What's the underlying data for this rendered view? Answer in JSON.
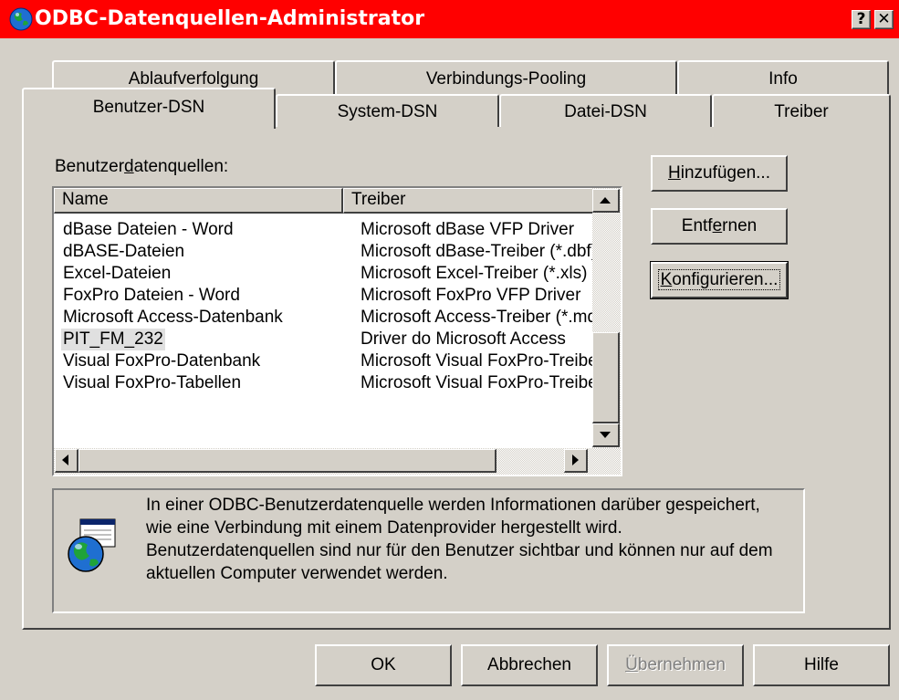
{
  "window": {
    "title": "ODBC-Datenquellen-Administrator",
    "help_glyph": "?",
    "close_glyph": "✕"
  },
  "tabs_back": [
    "Ablaufverfolgung",
    "Verbindungs-Pooling",
    "Info"
  ],
  "tabs_front": [
    "Benutzer-DSN",
    "System-DSN",
    "Datei-DSN",
    "Treiber"
  ],
  "active_tab": "Benutzer-DSN",
  "list_label": {
    "pre": "Benutzer",
    "accel": "d",
    "post": "atenquellen:"
  },
  "list": {
    "columns": [
      "Name",
      "Treiber"
    ],
    "rows": [
      {
        "name": "dBase Dateien - Word",
        "driver": "Microsoft dBase VFP Driver"
      },
      {
        "name": "dBASE-Dateien",
        "driver": "Microsoft dBase-Treiber (*.dbf)"
      },
      {
        "name": "Excel-Dateien",
        "driver": "Microsoft Excel-Treiber (*.xls)"
      },
      {
        "name": "FoxPro Dateien - Word",
        "driver": "Microsoft FoxPro VFP Driver"
      },
      {
        "name": "Microsoft Access-Datenbank",
        "driver": "Microsoft Access-Treiber (*.mdb)"
      },
      {
        "name": "PIT_FM_232",
        "driver": "Driver do Microsoft Access"
      },
      {
        "name": "Visual FoxPro-Datenbank",
        "driver": "Microsoft Visual FoxPro-Treiber"
      },
      {
        "name": "Visual FoxPro-Tabellen",
        "driver": "Microsoft Visual FoxPro-Treiber"
      }
    ],
    "selected_index": 5
  },
  "buttons": {
    "add": {
      "accel": "H",
      "rest": "inzufügen..."
    },
    "remove": {
      "pre": "Entf",
      "accel": "e",
      "rest": "rnen"
    },
    "configure": {
      "accel": "K",
      "rest": "onfigurieren..."
    }
  },
  "info_text": "In einer ODBC-Benutzerdatenquelle werden Informationen darüber gespeichert, wie eine Verbindung mit einem Datenprovider hergestellt wird. Benutzerdatenquellen sind nur für den Benutzer sichtbar und können nur auf dem aktuellen Computer verwendet werden.",
  "bottom_buttons": {
    "ok": "OK",
    "cancel": "Abbrechen",
    "apply": {
      "accel": "Ü",
      "rest": "bernehmen"
    },
    "help": "Hilfe"
  },
  "colors": {
    "titlebar": "#ff0000",
    "face": "#d4d0c8",
    "selection": "#e0e0e0"
  }
}
